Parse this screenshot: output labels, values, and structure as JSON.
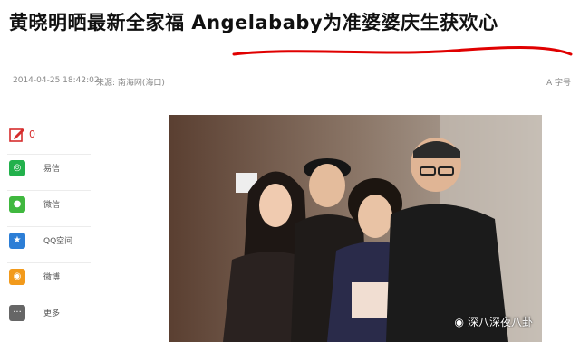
{
  "article": {
    "headline": "黄晓明晒最新全家福 Angelababy为准婆婆庆生获欢心",
    "date": "2014-04-25 18:42:02",
    "source_label": "来源:",
    "source_name": "南海网(海口)",
    "font_size_label": "A 字号"
  },
  "share": {
    "comment_count": "0",
    "items": [
      {
        "label": "易信",
        "icon": "yixin-icon",
        "color": "#22b14c"
      },
      {
        "label": "微信",
        "icon": "wechat-icon",
        "color": "#40b83f"
      },
      {
        "label": "QQ空间",
        "icon": "qzone-icon",
        "color": "#2c7ed6"
      },
      {
        "label": "微博",
        "icon": "weibo-icon",
        "color": "#f29a1b"
      },
      {
        "label": "更多",
        "icon": "more-icon",
        "color": "#666666"
      }
    ]
  },
  "photo": {
    "watermark": "深八深夜八卦"
  }
}
